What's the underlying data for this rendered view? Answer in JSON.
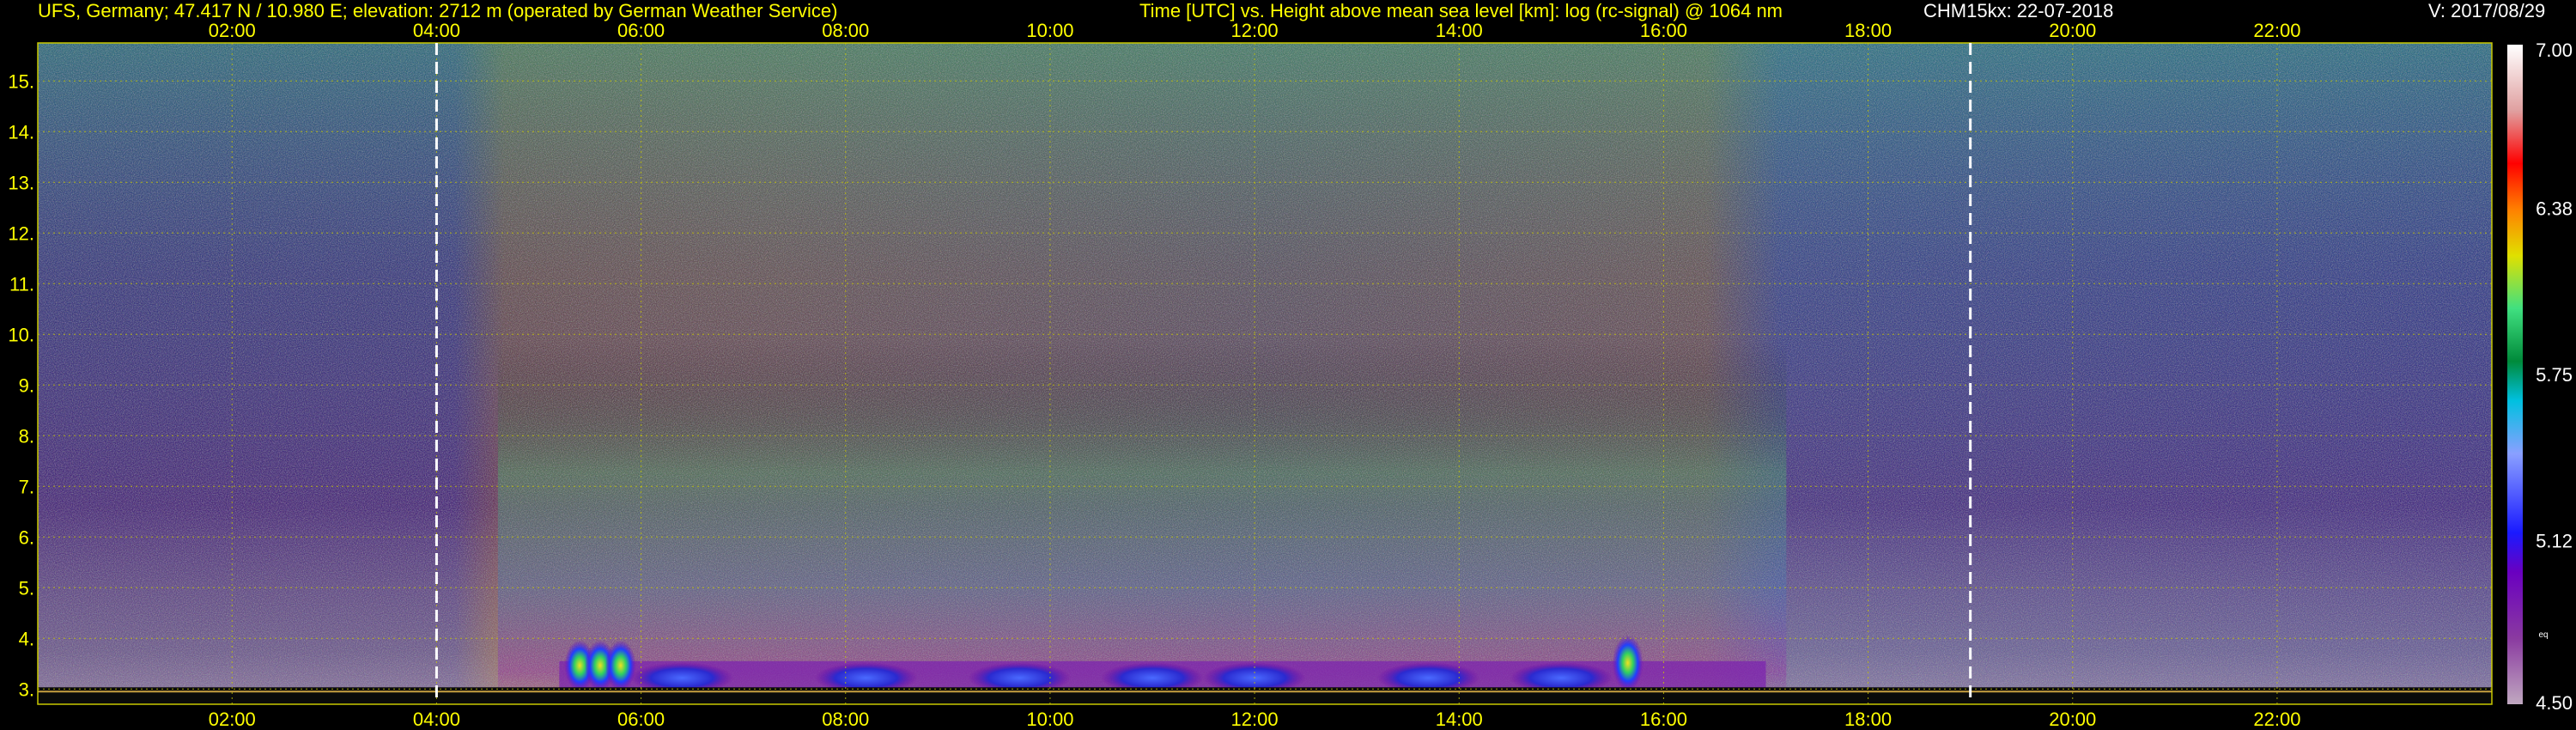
{
  "header": {
    "station": "UFS, Germany; 47.417 N / 10.980 E; elevation: 2712 m  (operated by German Weather Service)",
    "plot_title": "Time [UTC] vs. Height above mean sea level [km]: log (rc-signal) @ 1064 nm",
    "instrument_date": "CHM15kx: 22-07-2018",
    "version": "V: 2017/08/29"
  },
  "colors": {
    "background": "#000000",
    "header_text": "#ffff00",
    "tick_text": "#ffff00",
    "grid": "#c8c800",
    "marker_line": "#ffffff"
  },
  "chart_data": {
    "type": "heatmap",
    "title": "Time [UTC] vs. Height above mean sea level [km]: log (rc-signal) @ 1064 nm",
    "xlabel": "Time [UTC]",
    "ylabel": "Height above mean sea level [km]",
    "xlim": [
      0.1,
      24.1
    ],
    "ylim": [
      2.7,
      15.75
    ],
    "x_ticks": [
      "02:00",
      "04:00",
      "06:00",
      "08:00",
      "10:00",
      "12:00",
      "14:00",
      "16:00",
      "18:00",
      "20:00",
      "22:00"
    ],
    "x_tick_values": [
      2,
      4,
      6,
      8,
      10,
      12,
      14,
      16,
      18,
      20,
      22
    ],
    "y_ticks": [
      "3.",
      "4.",
      "5.",
      "6.",
      "7.",
      "8.",
      "9.",
      "10.",
      "11.",
      "12.",
      "13.",
      "14.",
      "15."
    ],
    "y_tick_values": [
      3,
      4,
      5,
      6,
      7,
      8,
      9,
      10,
      11,
      12,
      13,
      14,
      15
    ],
    "grid": true,
    "markers": [
      {
        "label": "dashed line",
        "x": 4.0
      },
      {
        "label": "dashed line",
        "x": 19.0
      }
    ],
    "colorbar": {
      "min": 4.5,
      "max": 7.0,
      "tick_labels": [
        "7.00",
        "6.38",
        "5.75",
        "5.12",
        "4.50"
      ],
      "tick_values": [
        7.0,
        6.38,
        5.75,
        5.12,
        4.5
      ],
      "unit_label": "eq"
    },
    "features": [
      {
        "description": "daytime background noise (high signal) spanning full height",
        "x_range": [
          4.5,
          17.3
        ],
        "y_range": [
          3.0,
          15.75
        ]
      },
      {
        "description": "boundary layer aerosol band",
        "x_range": [
          5.2,
          17.0
        ],
        "y_range": [
          3.0,
          3.5
        ]
      },
      {
        "description": "low clouds",
        "x_range": [
          5.3,
          5.9
        ],
        "y_range": [
          3.1,
          4.1
        ]
      },
      {
        "description": "low clouds",
        "x_range": [
          15.55,
          15.75
        ],
        "y_range": [
          3.1,
          4.2
        ]
      }
    ]
  }
}
